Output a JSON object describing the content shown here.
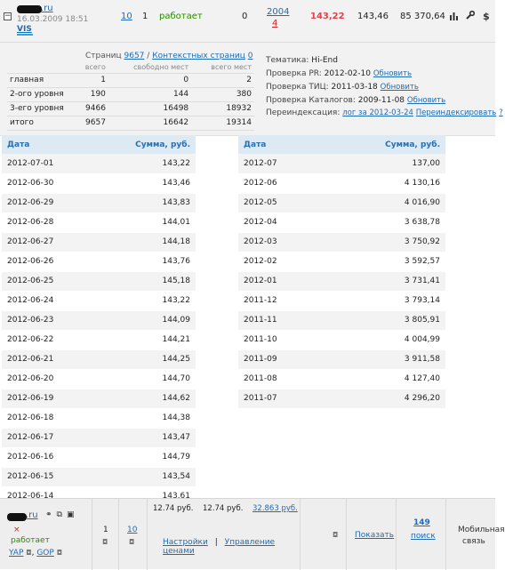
{
  "site": {
    "tld": ".ru",
    "date": "16.03.2009 18:51",
    "vis": "VIS",
    "col_a": "10",
    "col_b": "1",
    "status": "работает",
    "col_c": "0",
    "col_d_top": "2004",
    "col_d_bottom": "4",
    "price_main": "143,22",
    "price_secondary": "143,46",
    "balance": "85 370,64"
  },
  "pages": {
    "pages_label": "Страниц",
    "pages_value": "9657",
    "separator": "/",
    "context_label": "Контекстных страниц",
    "context_value": "0",
    "sub_headers": [
      "всего",
      "свободно мест",
      "всего мест"
    ],
    "rows": [
      {
        "label": "главная",
        "total": "1",
        "free": "0",
        "all": "2"
      },
      {
        "label": "2-ого уровня",
        "total": "190",
        "free": "144",
        "all": "380"
      },
      {
        "label": "3-его уровня",
        "total": "9466",
        "free": "16498",
        "all": "18932"
      },
      {
        "label": "итого",
        "total": "9657",
        "free": "16642",
        "all": "19314"
      }
    ]
  },
  "info": {
    "theme_label": "Тематика:",
    "theme_value": "Hi-End",
    "pr_label": "Проверка PR:",
    "pr_value": "2012-02-10",
    "tic_label": "Проверка ТИЦ:",
    "tic_value": "2011-03-18",
    "catalog_label": "Проверка Каталогов:",
    "catalog_value": "2009-11-08",
    "update": "Обновить",
    "reindex_label": "Переиндексация:",
    "reindex_log": "лог за 2012-03-24",
    "reindex_action": "Переиндексировать",
    "help": "?"
  },
  "daily": {
    "col_date": "Дата",
    "col_sum": "Сумма, руб.",
    "rows": [
      {
        "date": "2012-07-01",
        "sum": "143,22"
      },
      {
        "date": "2012-06-30",
        "sum": "143,46"
      },
      {
        "date": "2012-06-29",
        "sum": "143,83"
      },
      {
        "date": "2012-06-28",
        "sum": "144,01"
      },
      {
        "date": "2012-06-27",
        "sum": "144,18"
      },
      {
        "date": "2012-06-26",
        "sum": "143,76"
      },
      {
        "date": "2012-06-25",
        "sum": "145,18"
      },
      {
        "date": "2012-06-24",
        "sum": "143,22"
      },
      {
        "date": "2012-06-23",
        "sum": "144,09"
      },
      {
        "date": "2012-06-22",
        "sum": "144,21"
      },
      {
        "date": "2012-06-21",
        "sum": "144,25"
      },
      {
        "date": "2012-06-20",
        "sum": "144,70"
      },
      {
        "date": "2012-06-19",
        "sum": "144,62"
      },
      {
        "date": "2012-06-18",
        "sum": "144,38"
      },
      {
        "date": "2012-06-17",
        "sum": "143,47"
      },
      {
        "date": "2012-06-16",
        "sum": "144,79"
      },
      {
        "date": "2012-06-15",
        "sum": "143,54"
      },
      {
        "date": "2012-06-14",
        "sum": "143,61"
      }
    ]
  },
  "monthly": {
    "col_date": "Дата",
    "col_sum": "Сумма, руб.",
    "rows": [
      {
        "date": "2012-07",
        "sum": "137,00"
      },
      {
        "date": "2012-06",
        "sum": "4 130,16"
      },
      {
        "date": "2012-05",
        "sum": "4 016,90"
      },
      {
        "date": "2012-04",
        "sum": "3 638,78"
      },
      {
        "date": "2012-03",
        "sum": "3 750,92"
      },
      {
        "date": "2012-02",
        "sum": "3 592,57"
      },
      {
        "date": "2012-01",
        "sum": "3 731,41"
      },
      {
        "date": "2011-12",
        "sum": "3 793,14"
      },
      {
        "date": "2011-11",
        "sum": "3 805,91"
      },
      {
        "date": "2011-10",
        "sum": "4 004,99"
      },
      {
        "date": "2011-09",
        "sum": "3 911,58"
      },
      {
        "date": "2011-08",
        "sum": "4 127,40"
      },
      {
        "date": "2011-07",
        "sum": "4 296,20"
      }
    ]
  },
  "bottom": {
    "tld": ".ru",
    "x_mark": "×",
    "status": "работает",
    "link_yap": "YAP",
    "link_gop": "GOP",
    "col_one": "1",
    "col_ten": "10",
    "price_1": "12.74 руб.",
    "price_2": "12.74 руб.",
    "price_3": "32.863 руб.",
    "settings": "Настройки",
    "divider": "|",
    "price_manage": "Управление ценами",
    "show": "Показать",
    "search_count": "149",
    "search_label": "поиск",
    "mobile_line1": "Мобильная",
    "mobile_line2": "связь"
  }
}
